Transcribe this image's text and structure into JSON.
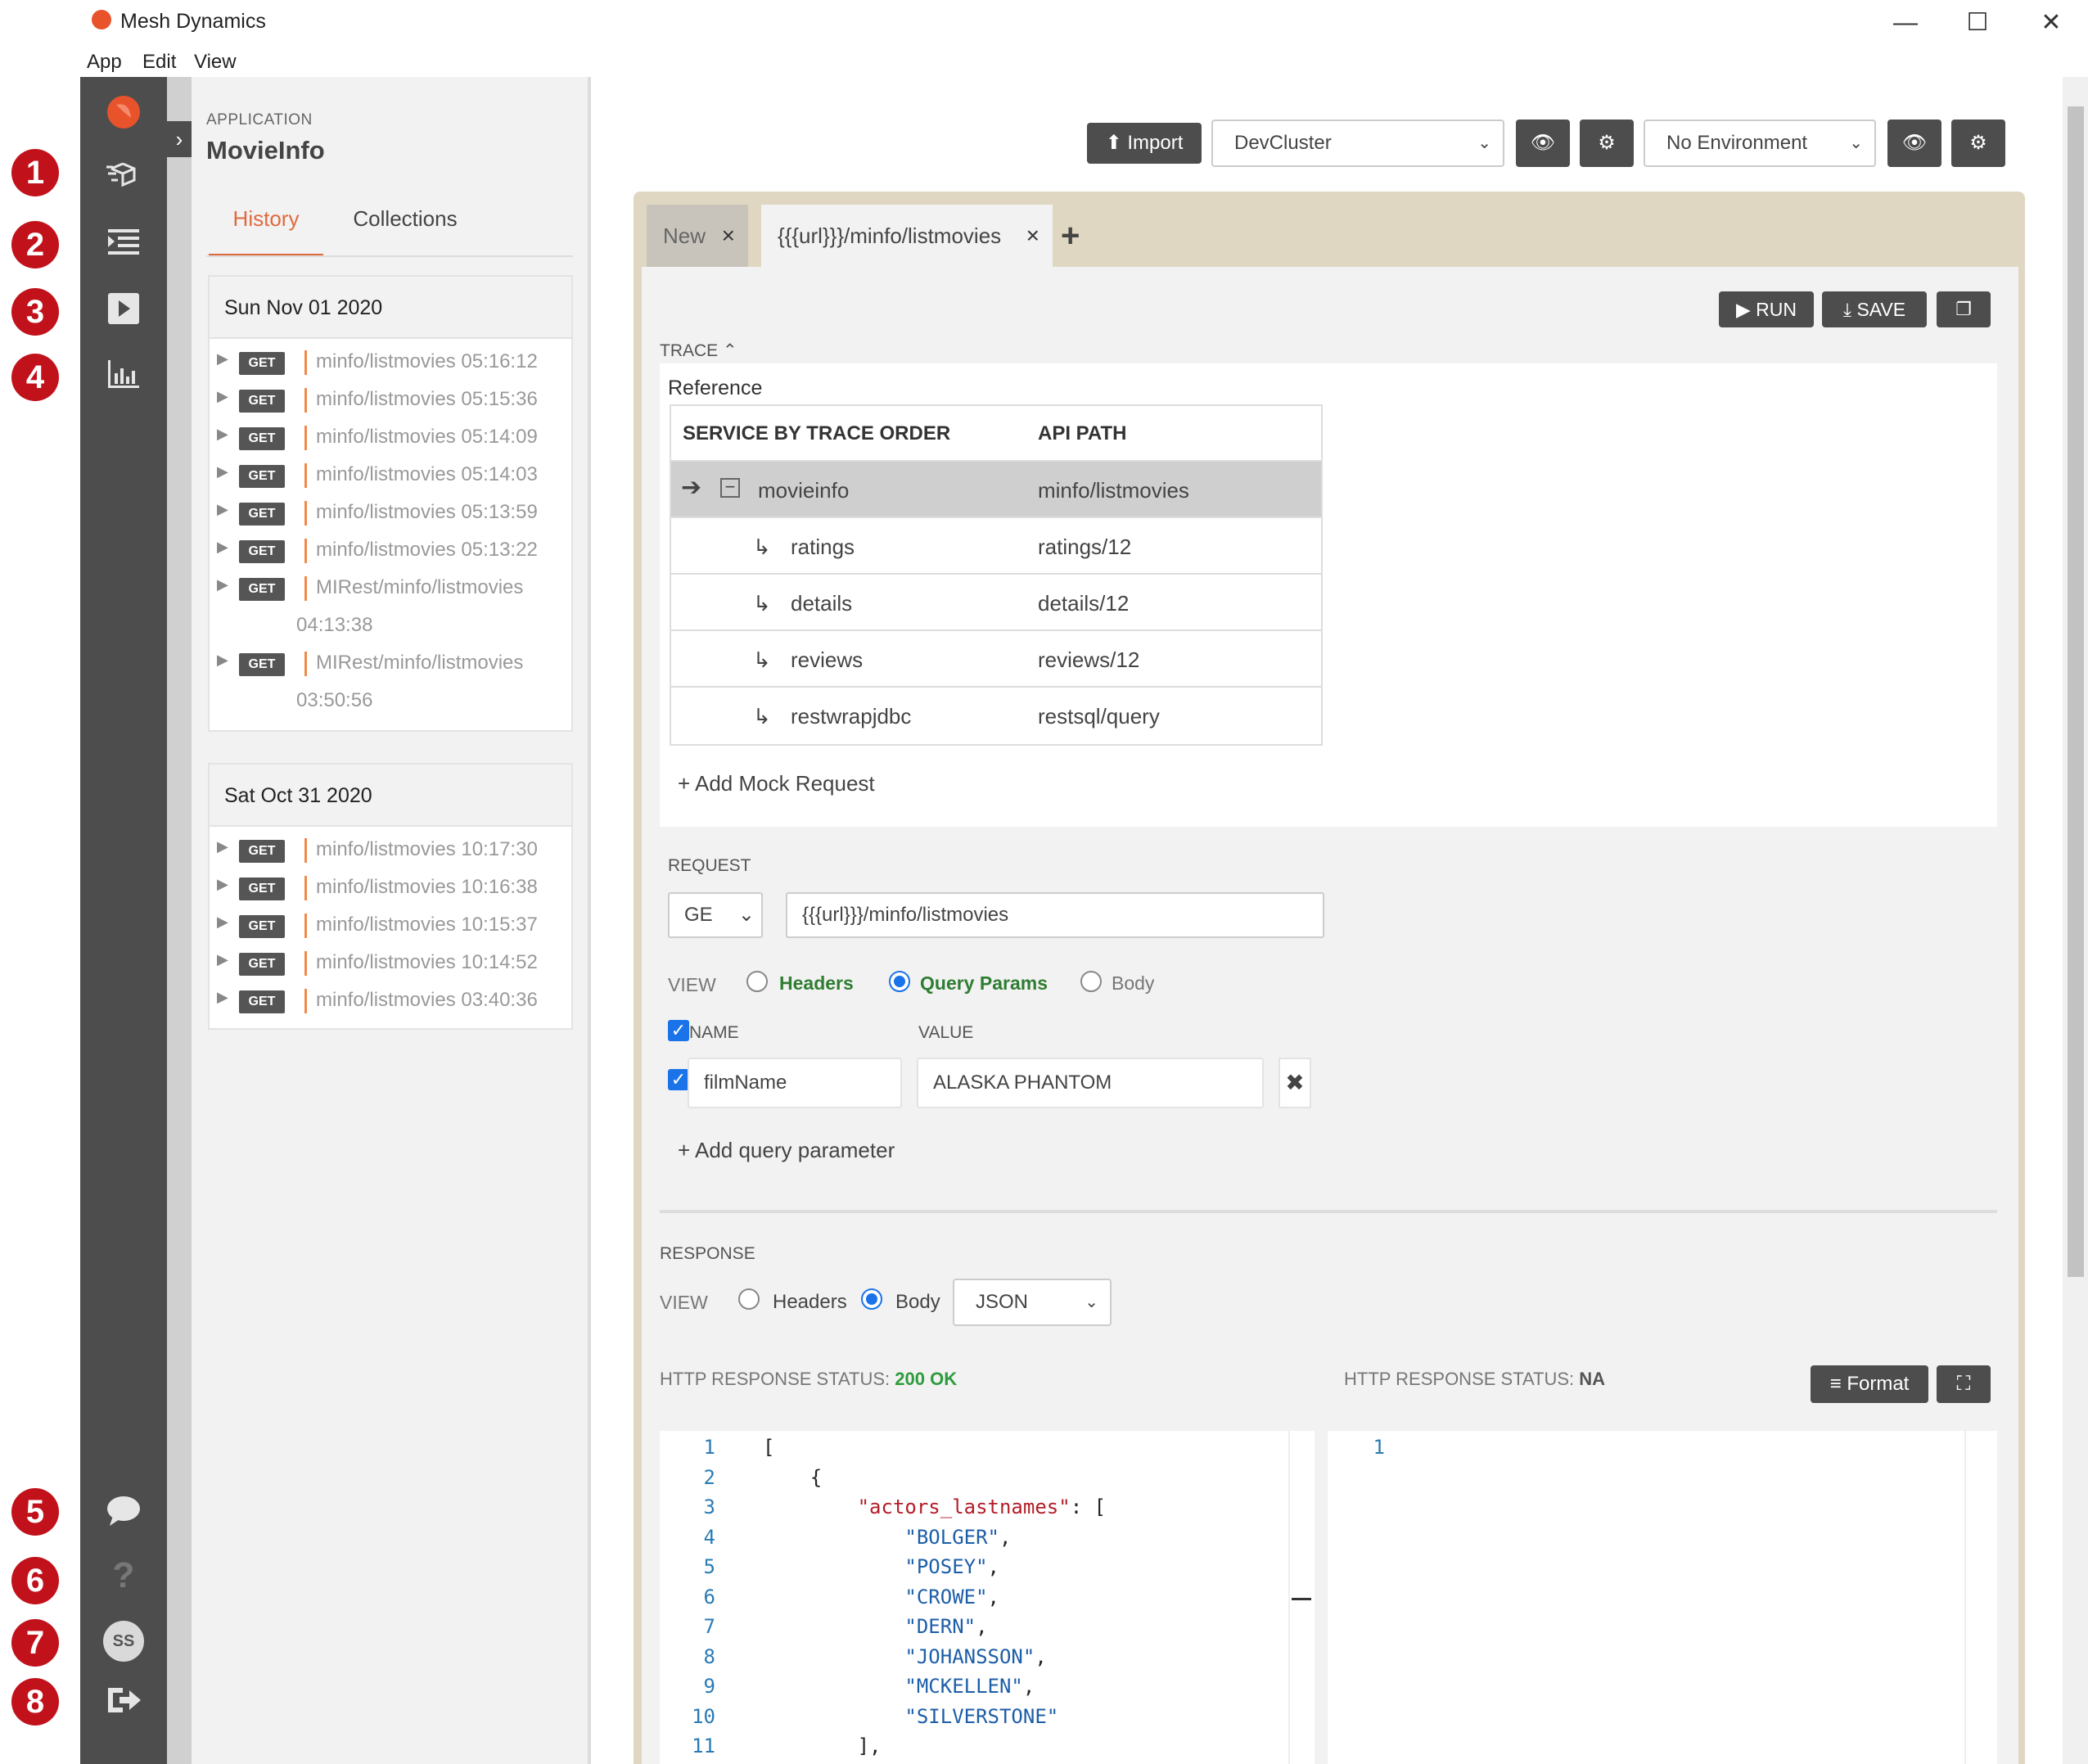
{
  "window": {
    "title": "Mesh Dynamics",
    "minimize": "—",
    "maximize": "☐",
    "close": "✕"
  },
  "menu": [
    "App",
    "Edit",
    "View"
  ],
  "annotations": [
    "1",
    "2",
    "3",
    "4",
    "5",
    "6",
    "7",
    "8"
  ],
  "sidebar_icons": [
    "logo-icon",
    "services-icon",
    "list-icon",
    "play-icon",
    "chart-icon",
    "chat-icon",
    "help-icon",
    "avatar",
    "logout-icon"
  ],
  "avatar_initials": "SS",
  "left": {
    "app_caption": "APPLICATION",
    "app_name": "MovieInfo",
    "tabs": [
      "History",
      "Collections"
    ],
    "days": [
      {
        "date": "Sun Nov 01 2020",
        "items": [
          {
            "method": "GET",
            "path": "minfo/listmovies 05:16:12"
          },
          {
            "method": "GET",
            "path": "minfo/listmovies 05:15:36"
          },
          {
            "method": "GET",
            "path": "minfo/listmovies 05:14:09"
          },
          {
            "method": "GET",
            "path": "minfo/listmovies 05:14:03"
          },
          {
            "method": "GET",
            "path": "minfo/listmovies 05:13:59"
          },
          {
            "method": "GET",
            "path": "minfo/listmovies 05:13:22"
          },
          {
            "method": "GET",
            "path": "MIRest/minfo/listmovies",
            "time": "04:13:38"
          },
          {
            "method": "GET",
            "path": "MIRest/minfo/listmovies",
            "time": "03:50:56"
          }
        ]
      },
      {
        "date": "Sat Oct 31 2020",
        "items": [
          {
            "method": "GET",
            "path": "minfo/listmovies 10:17:30"
          },
          {
            "method": "GET",
            "path": "minfo/listmovies 10:16:38"
          },
          {
            "method": "GET",
            "path": "minfo/listmovies 10:15:37"
          },
          {
            "method": "GET",
            "path": "minfo/listmovies 10:14:52"
          },
          {
            "method": "GET",
            "path": "minfo/listmovies 03:40:36"
          }
        ]
      }
    ]
  },
  "toolbar": {
    "import_label": "Import",
    "cluster": "DevCluster",
    "environment": "No Environment"
  },
  "tabs": [
    {
      "label": "New"
    },
    {
      "label": "{{{url}}}/minfo/listmovies"
    }
  ],
  "actions": {
    "run": "RUN",
    "save": "SAVE"
  },
  "trace": {
    "label": "TRACE",
    "reference": "Reference",
    "col_service": "SERVICE BY TRACE ORDER",
    "col_path": "API PATH",
    "rows": [
      {
        "service": "movieinfo",
        "path": "minfo/listmovies"
      },
      {
        "service": "ratings",
        "path": "ratings/12"
      },
      {
        "service": "details",
        "path": "details/12"
      },
      {
        "service": "reviews",
        "path": "reviews/12"
      },
      {
        "service": "restwrapjdbc",
        "path": "restsql/query"
      }
    ],
    "add_mock": "Add Mock Request"
  },
  "request": {
    "label": "REQUEST",
    "method": "GE",
    "url": "{{{url}}}/minfo/listmovies",
    "view_label": "VIEW",
    "view_options": [
      "Headers",
      "Query Params",
      "Body"
    ],
    "col_name": "NAME",
    "col_value": "VALUE",
    "param_name": "filmName",
    "param_value": "ALASKA PHANTOM",
    "add_param": "Add query parameter"
  },
  "response": {
    "label": "RESPONSE",
    "view_label": "VIEW",
    "view_options": [
      "Headers",
      "Body"
    ],
    "format_select": "JSON",
    "status_left_label": "HTTP RESPONSE STATUS:",
    "status_left_value": "200 OK",
    "status_right_label": "HTTP RESPONSE STATUS:",
    "status_right_value": "NA",
    "format_btn": "Format",
    "left_code": [
      "[",
      "    {",
      "        \"actors_lastnames\": [",
      "            \"BOLGER\",",
      "            \"POSEY\",",
      "            \"CROWE\",",
      "            \"DERN\",",
      "            \"JOHANSSON\",",
      "            \"MCKELLEN\",",
      "            \"SILVERSTONE\"",
      "        ],"
    ],
    "right_code_lines": [
      "1"
    ]
  }
}
